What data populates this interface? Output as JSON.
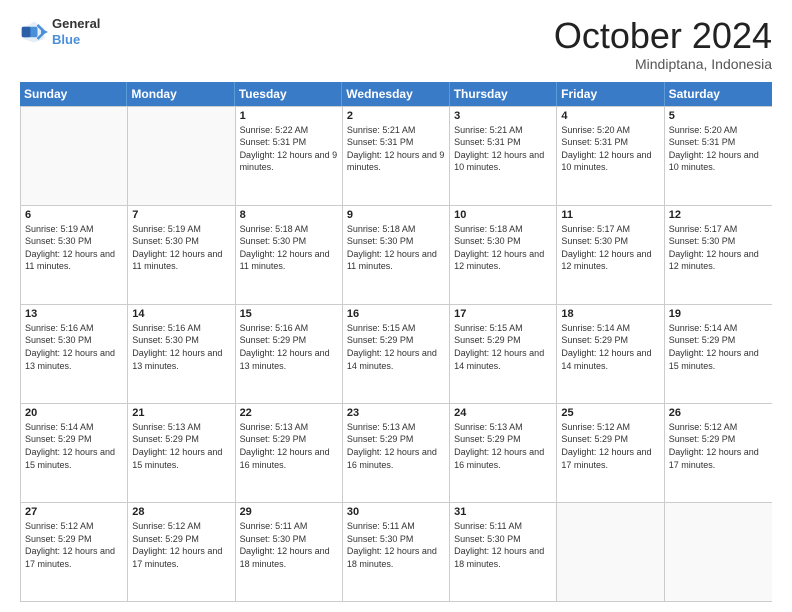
{
  "header": {
    "logo_general": "General",
    "logo_blue": "Blue",
    "month_title": "October 2024",
    "location": "Mindiptana, Indonesia"
  },
  "days_of_week": [
    "Sunday",
    "Monday",
    "Tuesday",
    "Wednesday",
    "Thursday",
    "Friday",
    "Saturday"
  ],
  "weeks": [
    [
      {
        "day": "",
        "empty": true
      },
      {
        "day": "",
        "empty": true
      },
      {
        "day": "1",
        "sunrise": "5:22 AM",
        "sunset": "5:31 PM",
        "daylight": "12 hours and 9 minutes."
      },
      {
        "day": "2",
        "sunrise": "5:21 AM",
        "sunset": "5:31 PM",
        "daylight": "12 hours and 9 minutes."
      },
      {
        "day": "3",
        "sunrise": "5:21 AM",
        "sunset": "5:31 PM",
        "daylight": "12 hours and 10 minutes."
      },
      {
        "day": "4",
        "sunrise": "5:20 AM",
        "sunset": "5:31 PM",
        "daylight": "12 hours and 10 minutes."
      },
      {
        "day": "5",
        "sunrise": "5:20 AM",
        "sunset": "5:31 PM",
        "daylight": "12 hours and 10 minutes."
      }
    ],
    [
      {
        "day": "6",
        "sunrise": "5:19 AM",
        "sunset": "5:30 PM",
        "daylight": "12 hours and 11 minutes."
      },
      {
        "day": "7",
        "sunrise": "5:19 AM",
        "sunset": "5:30 PM",
        "daylight": "12 hours and 11 minutes."
      },
      {
        "day": "8",
        "sunrise": "5:18 AM",
        "sunset": "5:30 PM",
        "daylight": "12 hours and 11 minutes."
      },
      {
        "day": "9",
        "sunrise": "5:18 AM",
        "sunset": "5:30 PM",
        "daylight": "12 hours and 11 minutes."
      },
      {
        "day": "10",
        "sunrise": "5:18 AM",
        "sunset": "5:30 PM",
        "daylight": "12 hours and 12 minutes."
      },
      {
        "day": "11",
        "sunrise": "5:17 AM",
        "sunset": "5:30 PM",
        "daylight": "12 hours and 12 minutes."
      },
      {
        "day": "12",
        "sunrise": "5:17 AM",
        "sunset": "5:30 PM",
        "daylight": "12 hours and 12 minutes."
      }
    ],
    [
      {
        "day": "13",
        "sunrise": "5:16 AM",
        "sunset": "5:30 PM",
        "daylight": "12 hours and 13 minutes."
      },
      {
        "day": "14",
        "sunrise": "5:16 AM",
        "sunset": "5:30 PM",
        "daylight": "12 hours and 13 minutes."
      },
      {
        "day": "15",
        "sunrise": "5:16 AM",
        "sunset": "5:29 PM",
        "daylight": "12 hours and 13 minutes."
      },
      {
        "day": "16",
        "sunrise": "5:15 AM",
        "sunset": "5:29 PM",
        "daylight": "12 hours and 14 minutes."
      },
      {
        "day": "17",
        "sunrise": "5:15 AM",
        "sunset": "5:29 PM",
        "daylight": "12 hours and 14 minutes."
      },
      {
        "day": "18",
        "sunrise": "5:14 AM",
        "sunset": "5:29 PM",
        "daylight": "12 hours and 14 minutes."
      },
      {
        "day": "19",
        "sunrise": "5:14 AM",
        "sunset": "5:29 PM",
        "daylight": "12 hours and 15 minutes."
      }
    ],
    [
      {
        "day": "20",
        "sunrise": "5:14 AM",
        "sunset": "5:29 PM",
        "daylight": "12 hours and 15 minutes."
      },
      {
        "day": "21",
        "sunrise": "5:13 AM",
        "sunset": "5:29 PM",
        "daylight": "12 hours and 15 minutes."
      },
      {
        "day": "22",
        "sunrise": "5:13 AM",
        "sunset": "5:29 PM",
        "daylight": "12 hours and 16 minutes."
      },
      {
        "day": "23",
        "sunrise": "5:13 AM",
        "sunset": "5:29 PM",
        "daylight": "12 hours and 16 minutes."
      },
      {
        "day": "24",
        "sunrise": "5:13 AM",
        "sunset": "5:29 PM",
        "daylight": "12 hours and 16 minutes."
      },
      {
        "day": "25",
        "sunrise": "5:12 AM",
        "sunset": "5:29 PM",
        "daylight": "12 hours and 17 minutes."
      },
      {
        "day": "26",
        "sunrise": "5:12 AM",
        "sunset": "5:29 PM",
        "daylight": "12 hours and 17 minutes."
      }
    ],
    [
      {
        "day": "27",
        "sunrise": "5:12 AM",
        "sunset": "5:29 PM",
        "daylight": "12 hours and 17 minutes."
      },
      {
        "day": "28",
        "sunrise": "5:12 AM",
        "sunset": "5:29 PM",
        "daylight": "12 hours and 17 minutes."
      },
      {
        "day": "29",
        "sunrise": "5:11 AM",
        "sunset": "5:30 PM",
        "daylight": "12 hours and 18 minutes."
      },
      {
        "day": "30",
        "sunrise": "5:11 AM",
        "sunset": "5:30 PM",
        "daylight": "12 hours and 18 minutes."
      },
      {
        "day": "31",
        "sunrise": "5:11 AM",
        "sunset": "5:30 PM",
        "daylight": "12 hours and 18 minutes."
      },
      {
        "day": "",
        "empty": true
      },
      {
        "day": "",
        "empty": true
      }
    ]
  ]
}
